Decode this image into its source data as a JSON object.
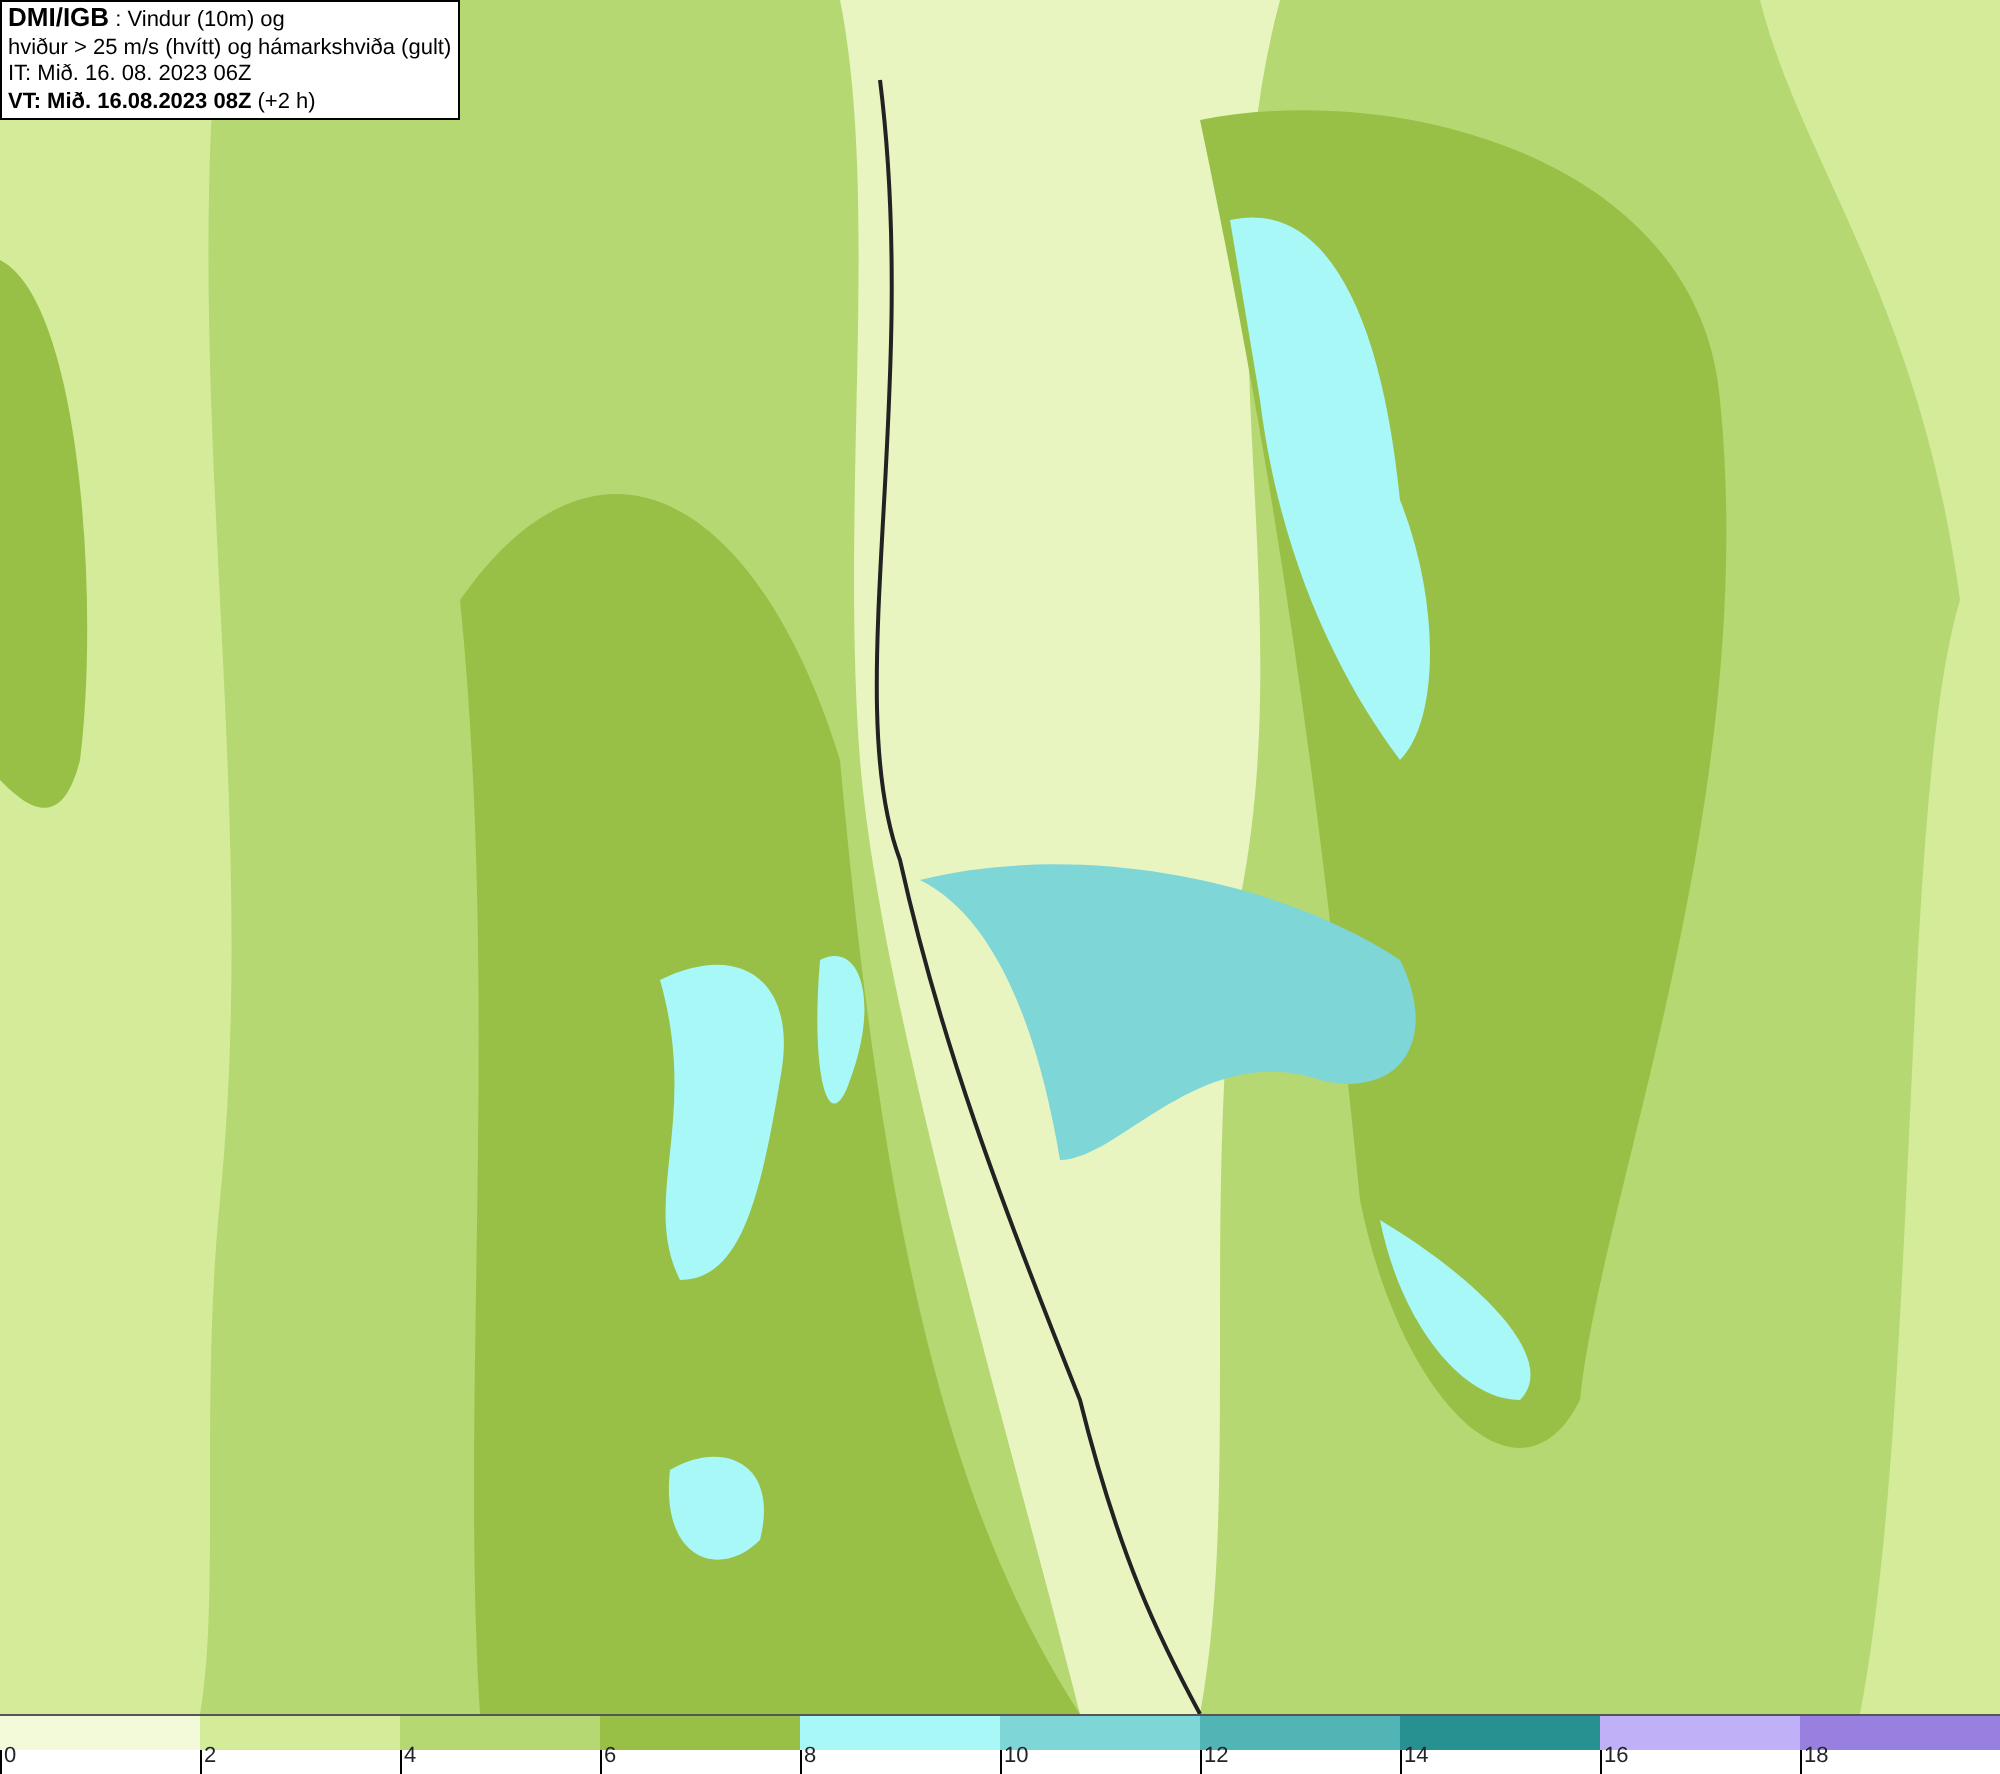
{
  "title_box": {
    "lines": [
      "**DMI/IGB** : Vindur (10m) og",
      "hviður > 25 m/s (hvítt) og hámarkshviða (gult)",
      "IT: Mið. 16. 08. 2023 06Z",
      "**VT: Mið. 16.08.2023 08Z** (+2 h)"
    ]
  },
  "legend": {
    "bins": [
      {
        "label": "0",
        "color": "#f2fada"
      },
      {
        "label": "2",
        "color": "#d4ec9a"
      },
      {
        "label": "4",
        "color": "#b6d872"
      },
      {
        "label": "6",
        "color": "#98c046"
      },
      {
        "label": "8",
        "color": "#a8f8f8"
      },
      {
        "label": "10",
        "color": "#7ed6d6"
      },
      {
        "label": "12",
        "color": "#52b5b5"
      },
      {
        "label": "14",
        "color": "#279090"
      },
      {
        "label": "16",
        "color": "#c0b0f8"
      },
      {
        "label": "18",
        "color": "#9880e0"
      }
    ]
  }
}
